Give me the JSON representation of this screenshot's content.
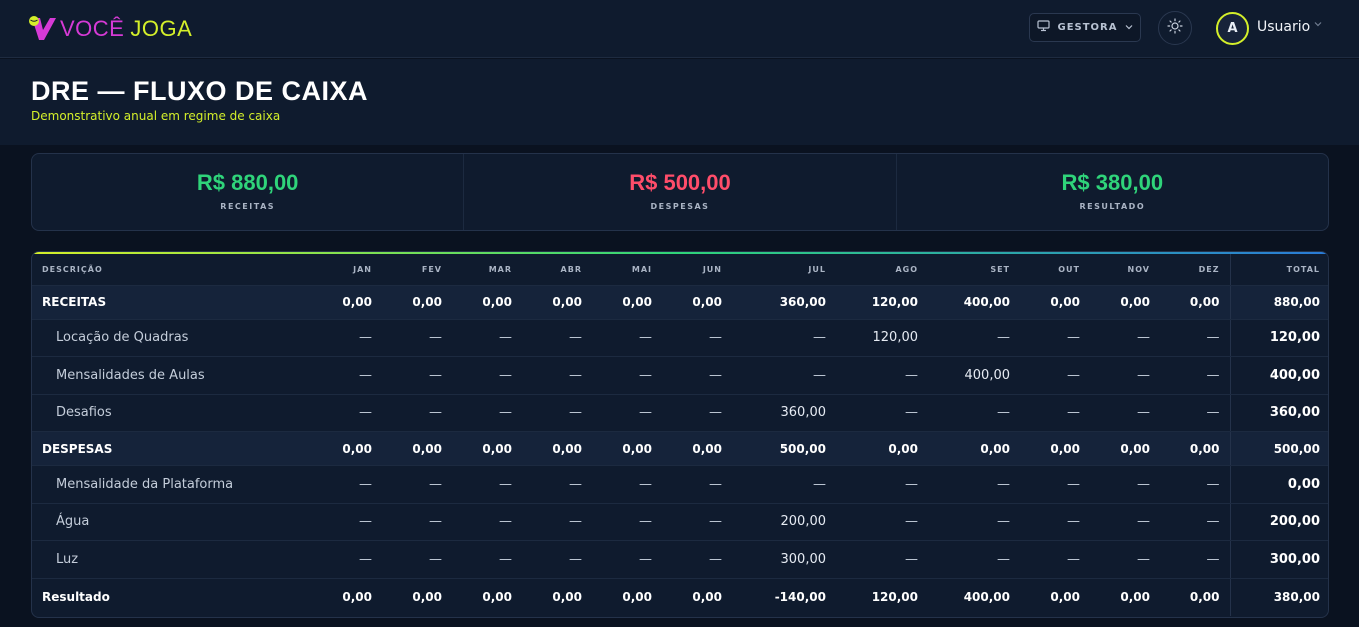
{
  "brand": {
    "word1": "VOCÊ",
    "word2": "JOGA"
  },
  "header": {
    "mode_label": "GESTORA",
    "avatar_initial": "A",
    "user_name": "Usuario"
  },
  "page": {
    "title": "DRE — FLUXO DE CAIXA",
    "subtitle": "Demonstrativo anual em regime de caixa"
  },
  "summary": [
    {
      "value": "R$ 880,00",
      "label": "RECEITAS",
      "tone": "green"
    },
    {
      "value": "R$ 500,00",
      "label": "DESPESAS",
      "tone": "red"
    },
    {
      "value": "R$ 380,00",
      "label": "RESULTADO",
      "tone": "green"
    }
  ],
  "table": {
    "columns": [
      "DESCRIÇÃO",
      "JAN",
      "FEV",
      "MAR",
      "ABR",
      "MAI",
      "JUN",
      "JUL",
      "AGO",
      "SET",
      "OUT",
      "NOV",
      "DEZ",
      "TOTAL"
    ],
    "rows": [
      {
        "type": "group",
        "cells": [
          "RECEITAS",
          "0,00",
          "0,00",
          "0,00",
          "0,00",
          "0,00",
          "0,00",
          "360,00",
          "120,00",
          "400,00",
          "0,00",
          "0,00",
          "0,00",
          "880,00"
        ]
      },
      {
        "type": "item",
        "cells": [
          "Locação de Quadras",
          "—",
          "—",
          "—",
          "—",
          "—",
          "—",
          "—",
          "120,00",
          "—",
          "—",
          "—",
          "—",
          "120,00"
        ]
      },
      {
        "type": "item",
        "cells": [
          "Mensalidades de Aulas",
          "—",
          "—",
          "—",
          "—",
          "—",
          "—",
          "—",
          "—",
          "400,00",
          "—",
          "—",
          "—",
          "400,00"
        ]
      },
      {
        "type": "item",
        "cells": [
          "Desafios",
          "—",
          "—",
          "—",
          "—",
          "—",
          "—",
          "360,00",
          "—",
          "—",
          "—",
          "—",
          "—",
          "360,00"
        ]
      },
      {
        "type": "group",
        "cells": [
          "DESPESAS",
          "0,00",
          "0,00",
          "0,00",
          "0,00",
          "0,00",
          "0,00",
          "500,00",
          "0,00",
          "0,00",
          "0,00",
          "0,00",
          "0,00",
          "500,00"
        ]
      },
      {
        "type": "item",
        "cells": [
          "Mensalidade da Plataforma",
          "—",
          "—",
          "—",
          "—",
          "—",
          "—",
          "—",
          "—",
          "—",
          "—",
          "—",
          "—",
          "0,00"
        ]
      },
      {
        "type": "item",
        "cells": [
          "Água",
          "—",
          "—",
          "—",
          "—",
          "—",
          "—",
          "200,00",
          "—",
          "—",
          "—",
          "—",
          "—",
          "200,00"
        ]
      },
      {
        "type": "item",
        "cells": [
          "Luz",
          "—",
          "—",
          "—",
          "—",
          "—",
          "—",
          "300,00",
          "—",
          "—",
          "—",
          "—",
          "—",
          "300,00"
        ]
      },
      {
        "type": "result",
        "cells": [
          "Resultado",
          "0,00",
          "0,00",
          "0,00",
          "0,00",
          "0,00",
          "0,00",
          "-140,00",
          "120,00",
          "400,00",
          "0,00",
          "0,00",
          "0,00",
          "380,00"
        ]
      }
    ]
  },
  "colors": {
    "positive": "#2fd47a",
    "negative": "#ff4d6a",
    "accent": "#d4ef2a",
    "brand_pink": "#d63ad6"
  },
  "icons": [
    "logo-mark-icon",
    "monitor-icon",
    "chevron-down-icon",
    "sun-icon"
  ]
}
